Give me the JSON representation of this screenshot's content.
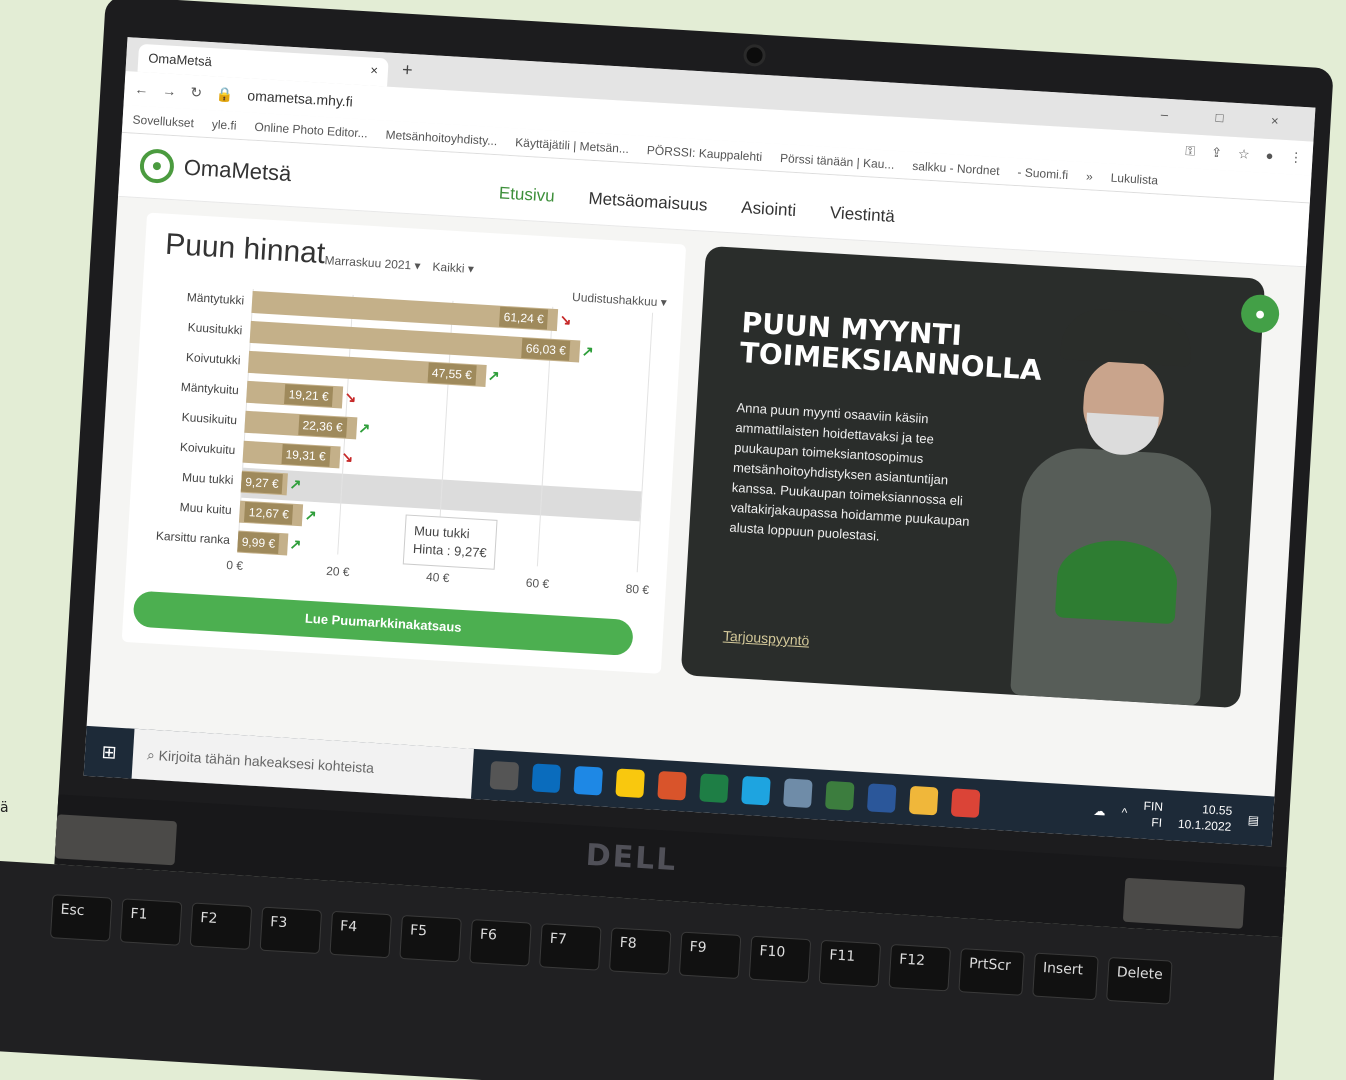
{
  "browser": {
    "tab_title": "OmaMetsä",
    "tab_close": "×",
    "new_tab": "+",
    "url": "omametsa.mhy.fi",
    "bookmarks": [
      "Sovellukset",
      "yle.fi",
      "Online Photo Editor...",
      "Metsänhoitoyhdisty...",
      "Käyttäjätili | Metsän...",
      "PÖRSSI: Kauppalehti",
      "Pörssi tänään | Kau...",
      "salkku - Nordnet",
      "- Suomi.fi",
      "»",
      "Lukulista"
    ]
  },
  "site": {
    "brand": "OmaMetsä",
    "nav": [
      "Etusivu",
      "Metsäomaisuus",
      "Asiointi",
      "Viestintä"
    ],
    "avatar_icon": "user-icon"
  },
  "prices": {
    "title": "Puun hinnat",
    "filter_month": "Marraskuu 2021",
    "filter_all": "Kaikki",
    "filter_type": "Uudistushakkuu",
    "tooltip_title": "Muu tukki",
    "tooltip_value": "Hinta : 9,27€",
    "button": "Lue Puumarkkinakatsaus"
  },
  "chart_data": {
    "type": "bar",
    "orientation": "horizontal",
    "categories": [
      "Mäntytukki",
      "Kuusitukki",
      "Koivutukki",
      "Mäntykuitu",
      "Kuusikuitu",
      "Koivukuitu",
      "Muu tukki",
      "Muu kuitu",
      "Karsittu ranka"
    ],
    "values": [
      61.24,
      66.03,
      47.55,
      19.21,
      22.36,
      19.31,
      9.27,
      12.67,
      9.99
    ],
    "value_labels": [
      "61,24 €",
      "66,03 €",
      "47,55 €",
      "19,21 €",
      "22,36 €",
      "19,31 €",
      "9,27 €",
      "12,67 €",
      "9,99 €"
    ],
    "trends": [
      "down",
      "up",
      "up",
      "down",
      "up",
      "down",
      "up",
      "up",
      "up"
    ],
    "xlim": [
      0,
      80
    ],
    "xticks": [
      "0 €",
      "20 €",
      "40 €",
      "60 €",
      "80 €"
    ],
    "bar_color": "#c4b089",
    "label_color": "#9f8a5c"
  },
  "promo": {
    "title": "PUUN MYYNTI TOIMEKSIANNOLLA",
    "body": "Anna puun myynti osaaviin käsiin ammattilaisten hoidettavaksi ja tee puukaupan toimeksiantosopimus metsänhoitoyhdistyksen asiantuntijan kanssa. Puukaupan toimeksiannossa eli valtakirjakaupassa hoidamme puukaupan alusta loppuun puolestasi.",
    "link": "Tarjouspyyntö"
  },
  "taskbar": {
    "search_placeholder": "Kirjoita tähän hakeaksesi kohteista",
    "lang_top": "FIN",
    "lang_bottom": "FI",
    "time": "10.55",
    "date": "10.1.2022"
  },
  "hardware": {
    "logo": "DELL",
    "keys": [
      "Esc",
      "F1",
      "F2",
      "F3",
      "F4",
      "F5",
      "F6",
      "F7",
      "F8",
      "F9",
      "F10",
      "F11",
      "F12",
      "PrtScr",
      "Insert",
      "Delete"
    ]
  },
  "edge_text": "ä",
  "colors": {
    "accent": "#4caf50",
    "brand": "#4b9b3f",
    "promo_bg": "#2a2d2b",
    "bg": "#e3edd5"
  }
}
